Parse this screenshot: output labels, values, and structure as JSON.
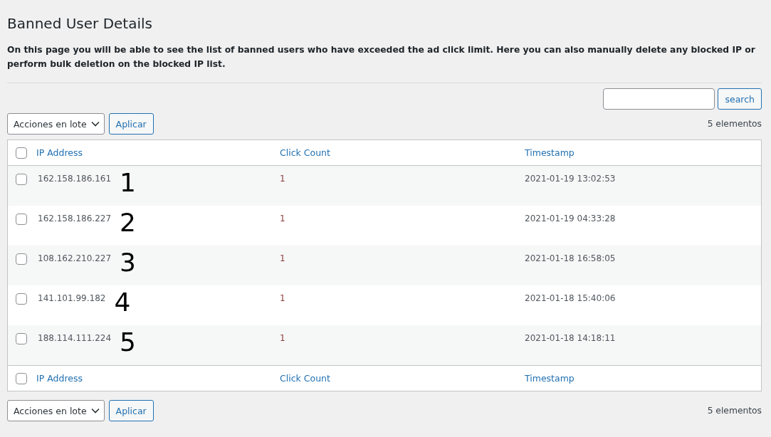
{
  "title": "Banned User Details",
  "description": "On this page you will be able to see the list of banned users who have exceeded the ad click limit. Here you can also manually delete any blocked IP or perform bulk deletion on the blocked IP list.",
  "search": {
    "button": "search"
  },
  "top_actions": {
    "bulk_select": "Acciones en lote",
    "apply": "Aplicar",
    "count": "5 elementos"
  },
  "table": {
    "columns": [
      "IP Address",
      "Click Count",
      "Timestamp"
    ],
    "select_all_checked": false,
    "rows": [
      {
        "ip": "162.158.186.161",
        "clicks": "1",
        "timestamp": "2021-01-19 13:02:53",
        "annotation": "1",
        "checked": false
      },
      {
        "ip": "162.158.186.227",
        "clicks": "1",
        "timestamp": "2021-01-19 04:33:28",
        "annotation": "2",
        "checked": false
      },
      {
        "ip": "108.162.210.227",
        "clicks": "1",
        "timestamp": "2021-01-18 16:58:05",
        "annotation": "3",
        "checked": false
      },
      {
        "ip": "141.101.99.182",
        "clicks": "1",
        "timestamp": "2021-01-18 15:40:06",
        "annotation": "4",
        "checked": false
      },
      {
        "ip": "188.114.111.224",
        "clicks": "1",
        "timestamp": "2021-01-18 14:18:11",
        "annotation": "5",
        "checked": false
      }
    ],
    "footer_columns": [
      "IP Address",
      "Click Count",
      "Timestamp"
    ],
    "footer_select_all_checked": false
  },
  "bottom_actions": {
    "bulk_select": "Acciones en lote",
    "apply": "Aplicar",
    "count": "5 elementos"
  }
}
